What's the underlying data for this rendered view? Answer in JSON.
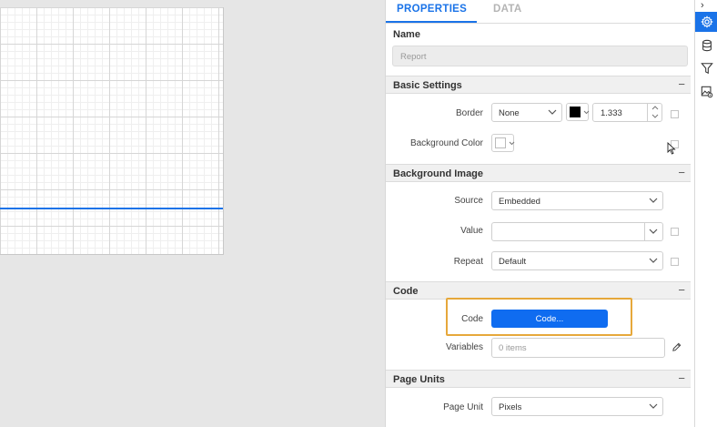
{
  "tabs": [
    {
      "label": "PROPERTIES",
      "active": true
    },
    {
      "label": "DATA",
      "active": false
    }
  ],
  "name": {
    "label": "Name",
    "value": "Report"
  },
  "basic_settings": {
    "title": "Basic Settings",
    "collapse": "−",
    "border": {
      "label": "Border",
      "style": "None",
      "color": "#000000",
      "width": "1.333"
    },
    "background_color": {
      "label": "Background Color",
      "color": "#ffffff"
    }
  },
  "background_image": {
    "title": "Background Image",
    "collapse": "−",
    "source": {
      "label": "Source",
      "value": "Embedded"
    },
    "value": {
      "label": "Value",
      "value": ""
    },
    "repeat": {
      "label": "Repeat",
      "value": "Default"
    }
  },
  "code": {
    "title": "Code",
    "collapse": "−",
    "code": {
      "label": "Code",
      "button": "Code..."
    },
    "variables": {
      "label": "Variables",
      "value": "0 items"
    }
  },
  "page_units": {
    "title": "Page Units",
    "collapse": "−",
    "page_unit": {
      "label": "Page Unit",
      "value": "Pixels"
    }
  },
  "toolbar": {
    "expand": "›",
    "items": [
      "gear-icon",
      "database-icon",
      "filter-icon",
      "image-settings-icon"
    ]
  },
  "colors": {
    "accent": "#1a73e8",
    "button": "#0f6cf0",
    "highlight": "#e6a83b"
  }
}
